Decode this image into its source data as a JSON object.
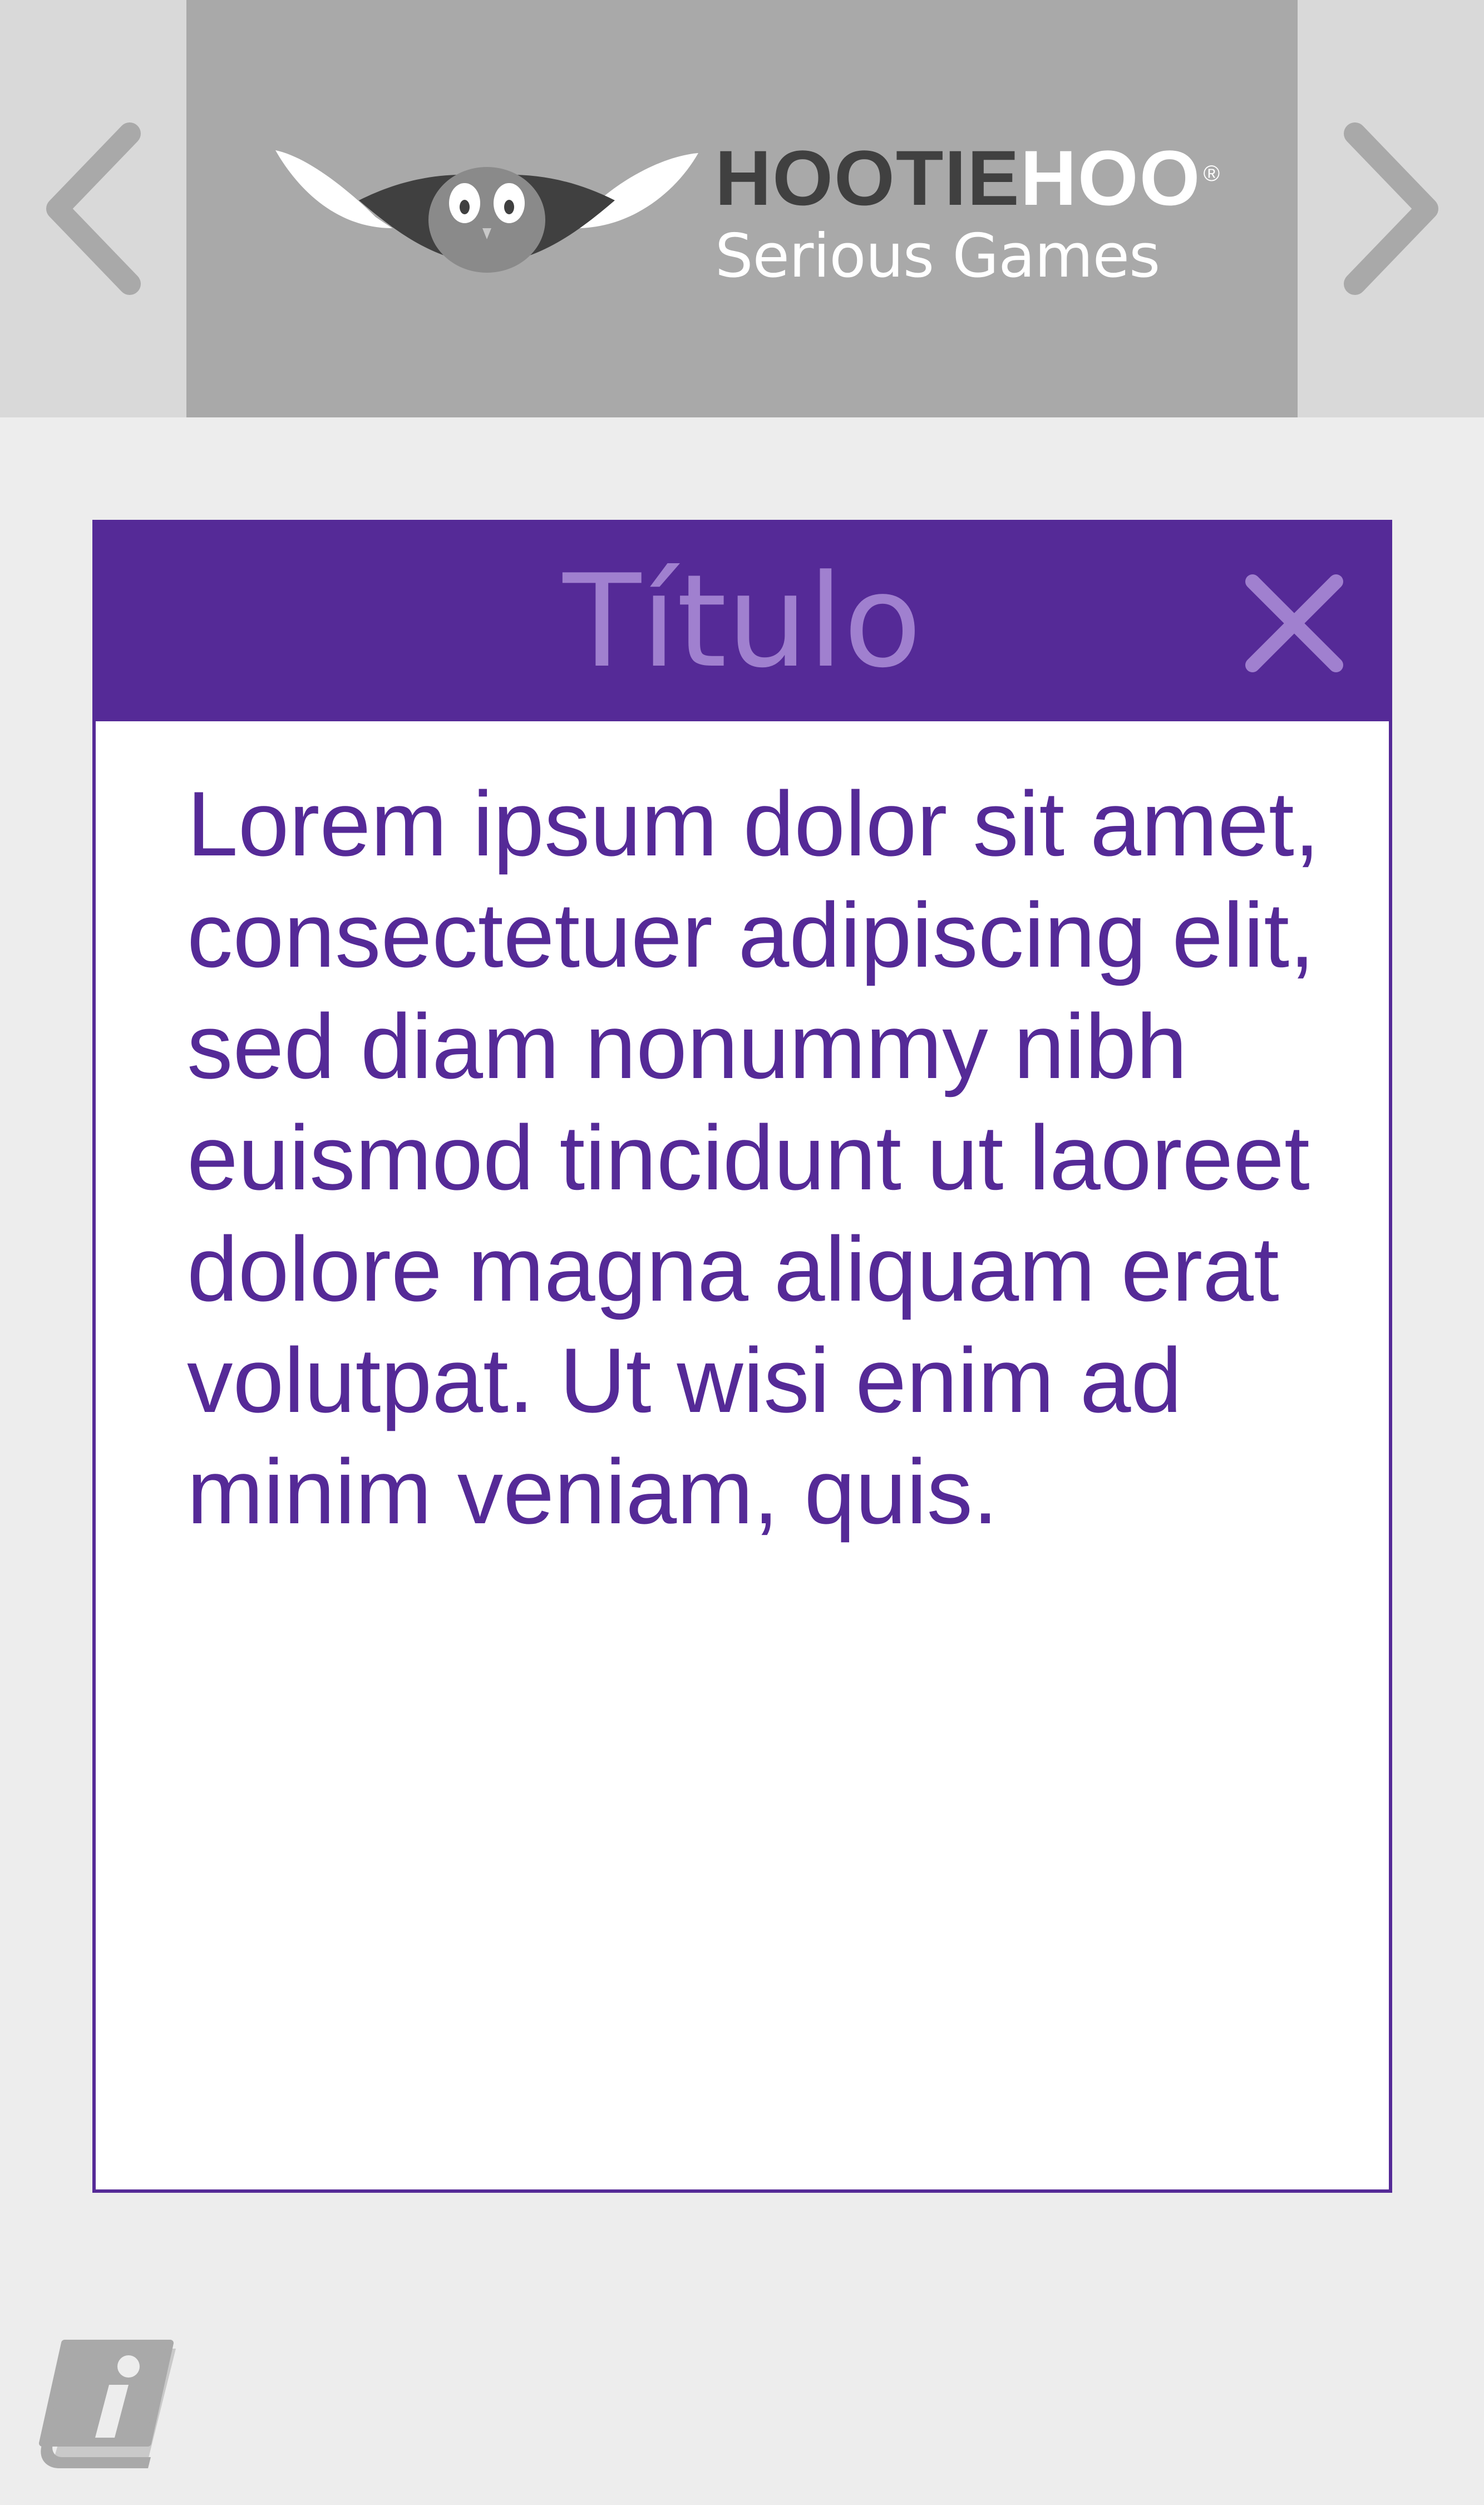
{
  "brand": {
    "name_part_1": "HOOTIE",
    "name_part_2": "HOO",
    "registered_mark": "®",
    "tagline": "Serious Games"
  },
  "navigation": {
    "prev_icon": "chevron-left-icon",
    "next_icon": "chevron-right-icon"
  },
  "dialog": {
    "title": "Título",
    "close_icon": "close-icon",
    "body_text": "Lorem ipsum dolor sit amet, consectetuer adipiscing elit, sed diam nonummy nibh euismod tincidunt ut laoreet dolore magna aliquam erat volutpat. Ut wisi enim ad minim veniam, quis."
  },
  "footer": {
    "info_icon": "info-book-icon"
  },
  "colors": {
    "accent": "#552a97",
    "title_text": "#a080cf",
    "header_band": "#a9a9a9",
    "header_side": "#d9d9d9",
    "page_background": "#ededed",
    "icon_gray": "#a9a9a9"
  }
}
